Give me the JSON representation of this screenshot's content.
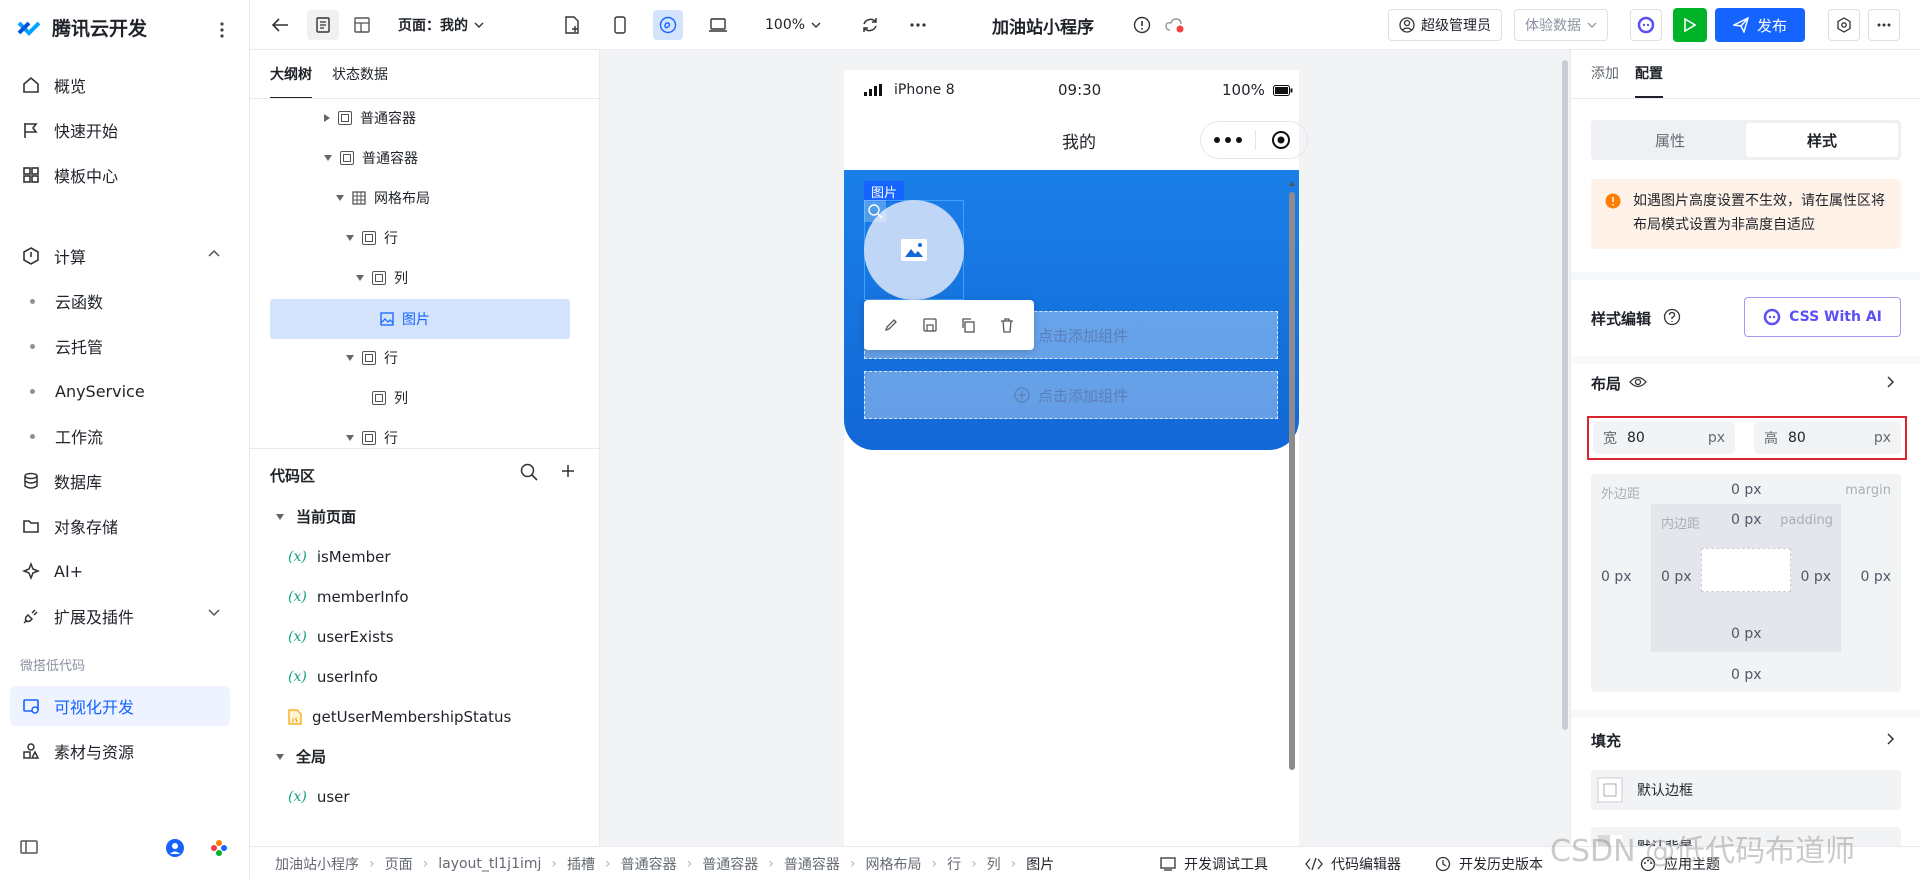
{
  "app": {
    "brand": "腾讯云开发"
  },
  "nav": {
    "items": [
      {
        "label": "概览"
      },
      {
        "label": "快速开始"
      },
      {
        "label": "模板中心"
      },
      {
        "label": "计算"
      },
      {
        "label": "云函数"
      },
      {
        "label": "云托管"
      },
      {
        "label": "AnyService"
      },
      {
        "label": "工作流"
      },
      {
        "label": "数据库"
      },
      {
        "label": "对象存储"
      },
      {
        "label": "AI+"
      },
      {
        "label": "扩展及插件"
      },
      {
        "label": "可视化开发"
      },
      {
        "label": "素材与资源"
      }
    ],
    "group_label": "微搭低代码"
  },
  "topbar": {
    "page_label": "页面：我的",
    "zoom": "100%",
    "app_title": "加油站小程序",
    "admin_label": "超级管理员",
    "data_label": "体验数据",
    "publish_label": "发布"
  },
  "outline": {
    "tabs": [
      "大纲树",
      "状态数据"
    ],
    "nodes": [
      {
        "label": "普通容器"
      },
      {
        "label": "普通容器"
      },
      {
        "label": "网格布局"
      },
      {
        "label": "行"
      },
      {
        "label": "列"
      },
      {
        "label": "图片"
      },
      {
        "label": "行"
      },
      {
        "label": "列"
      },
      {
        "label": "行"
      }
    ]
  },
  "code": {
    "title": "代码区",
    "current_page": "当前页面",
    "vars": [
      "isMember",
      "memberInfo",
      "userExists",
      "userInfo"
    ],
    "func": "getUserMembershipStatus",
    "global": "全局",
    "global_vars": [
      "user"
    ],
    "x_glyph": "(x)"
  },
  "phone": {
    "device": "iPhone 8",
    "time": "09:30",
    "battery": "100%",
    "title": "我的",
    "image_tag": "图片",
    "add_component": "点击添加组件"
  },
  "right": {
    "tabs": [
      "添加",
      "配置"
    ],
    "subtabs": [
      "属性",
      "样式"
    ],
    "notice": "如遇图片高度设置不生效，请在属性区将布局模式设置为非高度自适应",
    "style_edit": "样式编辑",
    "css_ai": "CSS With AI",
    "layout": "布局",
    "width_label": "宽",
    "width_value": "80",
    "height_label": "高",
    "height_value": "80",
    "unit": "px",
    "margin_label": "外边距",
    "margin_word": "margin",
    "padding_label": "内边距",
    "padding_word": "padding",
    "zero": "0 px",
    "fill": "填充",
    "default_border": "默认边框",
    "default_bg": "默认背景"
  },
  "bread": {
    "crumbs": [
      "加油站小程序",
      "页面",
      "layout_tl1j1imj",
      "插槽",
      "普通容器",
      "普通容器",
      "普通容器",
      "网格布局",
      "行",
      "列",
      "图片"
    ],
    "tools": [
      "开发调试工具",
      "代码编辑器",
      "开发历史版本",
      "应用主题"
    ]
  },
  "watermark": "CSDN @低代码布道师",
  "colors": {
    "accent": "#1664ff",
    "highlight": "#d4e3fc",
    "phone_gradient": "#1a7fe8",
    "green": "#00b42a",
    "red_box": "#d9232d"
  }
}
